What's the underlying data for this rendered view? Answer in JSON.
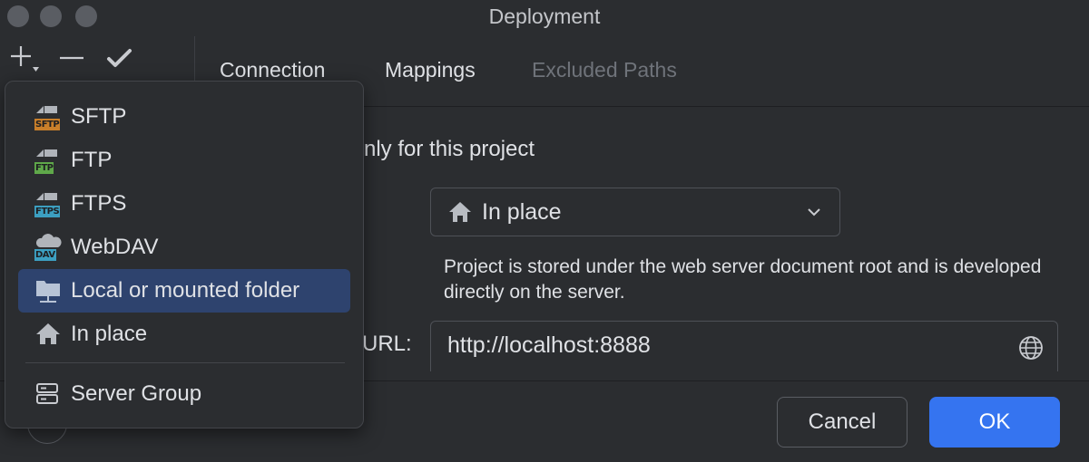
{
  "window": {
    "title": "Deployment"
  },
  "toolbar": {
    "add_icon": "plus-dropdown-icon",
    "remove_icon": "minus-icon",
    "default_icon": "check-icon"
  },
  "tabs": [
    {
      "label": "Connection",
      "state": "active"
    },
    {
      "label": "Mappings",
      "state": "enabled"
    },
    {
      "label": "Excluded Paths",
      "state": "disabled"
    }
  ],
  "form": {
    "visible_checkbox_label": "nly for this project",
    "type": {
      "value": "In place",
      "icon": "home-icon"
    },
    "description": "Project is stored under the web server document root and is developed directly on the server.",
    "url_label": "URL:",
    "url_value": "http://localhost:8888"
  },
  "buttons": {
    "cancel": "Cancel",
    "ok": "OK"
  },
  "popup": {
    "items": [
      {
        "label": "SFTP",
        "icon": "sftp-icon",
        "badge": "SFTP",
        "color": "#c97f2a"
      },
      {
        "label": "FTP",
        "icon": "ftp-icon",
        "badge": "FTP",
        "color": "#5fa84a"
      },
      {
        "label": "FTPS",
        "icon": "ftps-icon",
        "badge": "FTPS",
        "color": "#3c9fc1"
      },
      {
        "label": "WebDAV",
        "icon": "webdav-icon",
        "badge": "DAV",
        "color": "#3c9fc1"
      },
      {
        "label": "Local or mounted folder",
        "icon": "local-folder-icon",
        "selected": true
      },
      {
        "label": "In place",
        "icon": "home-icon"
      },
      {
        "label": "Server Group",
        "icon": "server-group-icon"
      }
    ]
  },
  "colors": {
    "accent": "#3574f0",
    "selection": "#2e436e",
    "background": "#2b2d30"
  }
}
